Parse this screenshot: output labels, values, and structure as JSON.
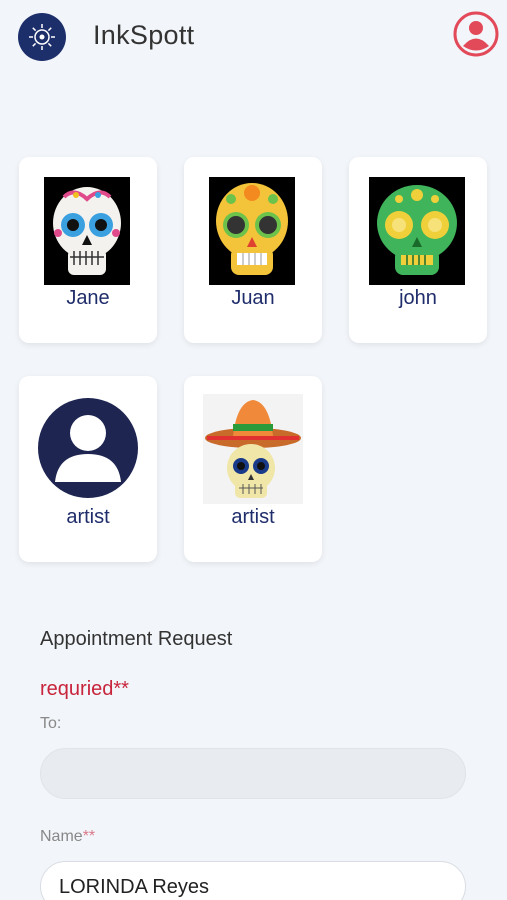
{
  "app": {
    "title": "InkSpott",
    "logo_icon": "compass-logo-icon",
    "profile_icon": "user-profile-icon",
    "accent": "#1d2f6b",
    "profile_color": "#e24a5a"
  },
  "artists": [
    {
      "name": "Jane",
      "image": "sugar-skull-colorful"
    },
    {
      "name": "Juan",
      "image": "sugar-skull-yellow"
    },
    {
      "name": "john",
      "image": "sugar-skull-green"
    },
    {
      "name": "artist",
      "image": "default-avatar"
    },
    {
      "name": "artist",
      "image": "sombrero-skull"
    }
  ],
  "form": {
    "title": "Appointment Request",
    "required_note": "requried**",
    "to_label": "To:",
    "to_value": "",
    "name_label": "Name",
    "name_required_mark": "**",
    "name_value": "LORINDA Reyes"
  }
}
